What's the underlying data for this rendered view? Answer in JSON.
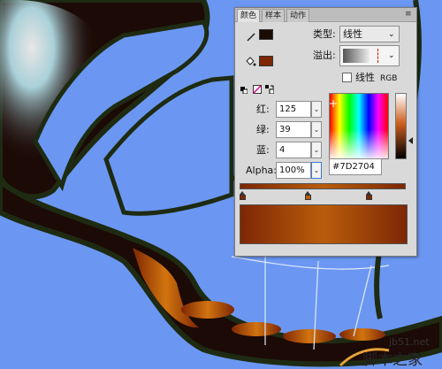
{
  "panel": {
    "tabs": [
      {
        "label": "颜色",
        "active": true
      },
      {
        "label": "样本",
        "active": false
      },
      {
        "label": "动作",
        "active": false
      }
    ],
    "menu_icon": "panel-menu-icon",
    "stroke_color": "#1a0c04",
    "fill_color": "#7D2704",
    "type_label": "类型:",
    "type_value": "线性",
    "overflow_label": "溢出:",
    "linear_rgb_label": "线性",
    "linear_rgb_suffix": "RGB",
    "linear_rgb_checked": false,
    "red_label": "红:",
    "red_value": "125",
    "green_label": "绿:",
    "green_value": "39",
    "blue_label": "蓝:",
    "blue_value": "4",
    "alpha_label": "Alpha:",
    "alpha_value": "100%",
    "hex_value": "#7D2704",
    "gradient_start": "#7D2704",
    "gradient_mid": "#B95D0C",
    "gradient_end": "#7D2704"
  },
  "watermark": {
    "site": "jb51.net",
    "name": "脚本之家"
  },
  "colors": {
    "background": "#6b97f2",
    "wing_dark": "#1c0a06",
    "wing_outline": "#1e2b12"
  }
}
